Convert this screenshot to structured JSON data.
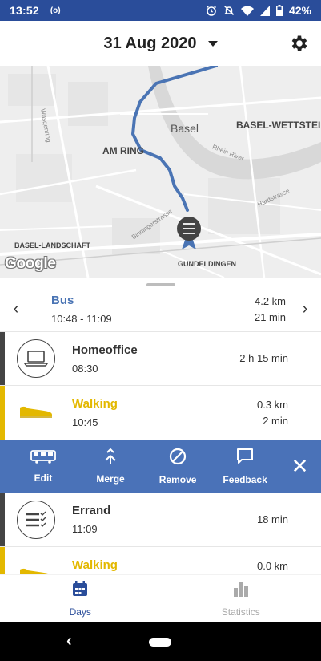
{
  "status_bar": {
    "time": "13:52",
    "recording_indicator": "(o)",
    "battery_percent": "42%",
    "icons": [
      "alarm-icon",
      "bell-off-icon",
      "wifi-icon",
      "cell-signal-icon",
      "battery-icon"
    ]
  },
  "header": {
    "date": "31 Aug 2020",
    "dropdown_icon": "caret-down-icon",
    "settings_icon": "gear-icon"
  },
  "map": {
    "labels": {
      "basel": "Basel",
      "basel_wettstein": "BASEL-WETTSTEIN",
      "am_ring": "AM RING",
      "basel_landschaft": "BASEL-LANDSCHAFT",
      "gundeldingen": "GUNDELDINGEN",
      "rhine": "Rhein River",
      "waldenburg": "Wasgenring",
      "binningerstrasse": "Binningerstrasse",
      "hardstrasse": "Hardstrasse"
    },
    "attribution": "Google",
    "colors": {
      "route": "#4a74b4",
      "marker": "#444444",
      "water": "#d8d8d8"
    }
  },
  "trip_summary": {
    "prev_icon": "chevron-left-icon",
    "next_icon": "chevron-right-icon",
    "mode": "Bus",
    "time_range": "10:48 - 11:09",
    "distance": "4.2 km",
    "duration": "21 min"
  },
  "entries": [
    {
      "title": "Homeoffice",
      "time": "08:30",
      "value1": "2 h 15 min",
      "value2": "",
      "icon": "laptop-icon",
      "kind": "place"
    },
    {
      "title": "Walking",
      "time": "10:45",
      "value1": "0.3 km",
      "value2": "2 min",
      "icon": "shoe-icon",
      "kind": "walking"
    },
    {
      "title": "Errand",
      "time": "11:09",
      "value1": "18 min",
      "value2": "",
      "icon": "checklist-icon",
      "kind": "place"
    },
    {
      "title": "Walking",
      "time": "",
      "value1": "0.0 km",
      "value2": "",
      "icon": "shoe-icon",
      "kind": "walking"
    }
  ],
  "action_bar": {
    "edit": "Edit",
    "merge": "Merge",
    "remove": "Remove",
    "feedback": "Feedback",
    "close": "✕"
  },
  "bottom_nav": {
    "days": "Days",
    "statistics": "Statistics"
  },
  "colors": {
    "status_bar": "#2a4d9a",
    "accent": "#4a72b8",
    "walking": "#e3b800",
    "place_bar": "#444444",
    "inactive_tab": "#aaaaaa"
  }
}
